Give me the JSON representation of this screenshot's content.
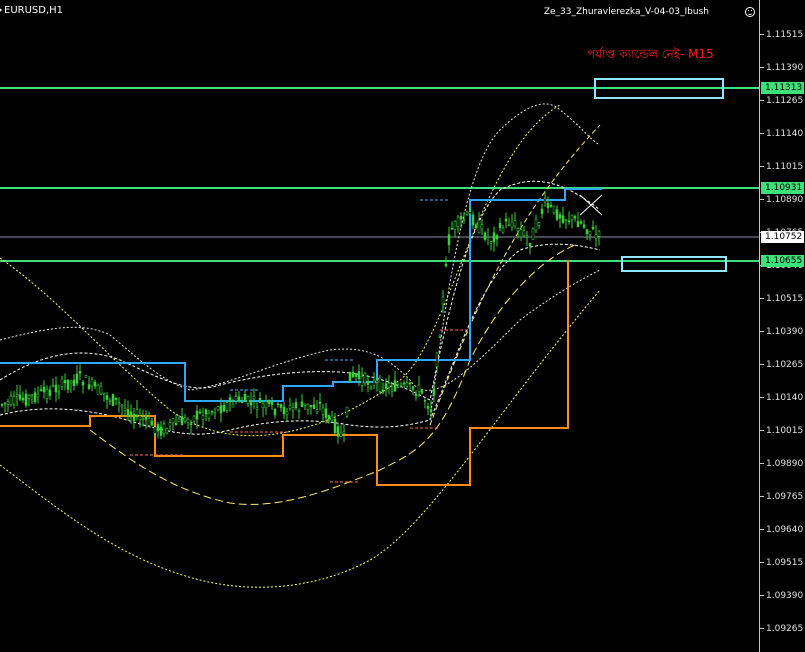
{
  "window": {
    "symbol_timeframe": "EURUSD,H1",
    "indicator_name": "Ze_33_Zhuravlerezka_V-04-03_Ibush",
    "status_text": "পর্যাপ্ত ক্যান্ডেল নেই- M15"
  },
  "price_axis": {
    "ticks": [
      "1.11515",
      "1.11390",
      "1.11265",
      "1.11140",
      "1.11015",
      "1.10890",
      "1.10765",
      "1.10640",
      "1.10515",
      "1.10390",
      "1.10265",
      "1.10140",
      "1.10015",
      "1.09890",
      "1.09765",
      "1.09640",
      "1.09515",
      "1.09390",
      "1.09265"
    ]
  },
  "level_tags": {
    "upper": "1.11313",
    "middle": "1.10931",
    "current": "1.10752",
    "lower": "1.10655"
  },
  "colors": {
    "background": "#000000",
    "level_line": "#3ee07a",
    "box": "#8ee6ff",
    "resistance": "#2ea8ff",
    "support": "#ff8c1a",
    "envelope": "#ffffff",
    "outer_band": "#ffff33",
    "candles": "#3ccf3c",
    "status_text": "#ff1a1a"
  }
}
